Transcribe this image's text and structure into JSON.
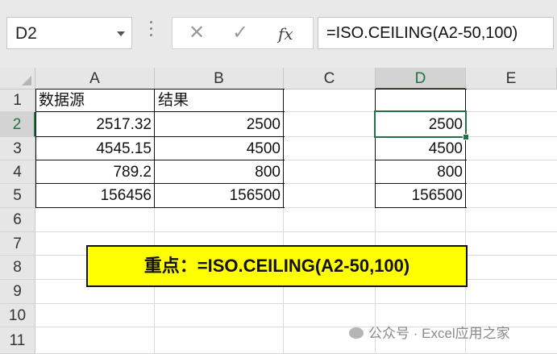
{
  "formula_bar": {
    "name_box": "D2",
    "cancel_glyph": "✕",
    "enter_glyph": "✓",
    "fx_label": "fx",
    "formula": "=ISO.CEILING(A2-50,100)"
  },
  "sheet": {
    "columns": [
      "A",
      "B",
      "C",
      "D",
      "E"
    ],
    "selected_column": "D",
    "rows": [
      "1",
      "2",
      "3",
      "4",
      "5",
      "6",
      "7",
      "8",
      "9",
      "10",
      "11"
    ],
    "selected_row": "2",
    "selected_cell": "D2",
    "cells": {
      "A1": "数据源",
      "B1": "结果",
      "A2": "2517.32",
      "B2": "2500",
      "A3": "4545.15",
      "B3": "4500",
      "A4": "789.2",
      "B4": "800",
      "A5": "156456",
      "B5": "156500",
      "D2": "2500",
      "D3": "4500",
      "D4": "800",
      "D5": "156500"
    }
  },
  "callout": "重点：=ISO.CEILING(A2-50,100)",
  "watermark": "公众号 · Excel应用之家",
  "colors": {
    "accent": "#217346",
    "callout_bg": "#ffff00"
  }
}
